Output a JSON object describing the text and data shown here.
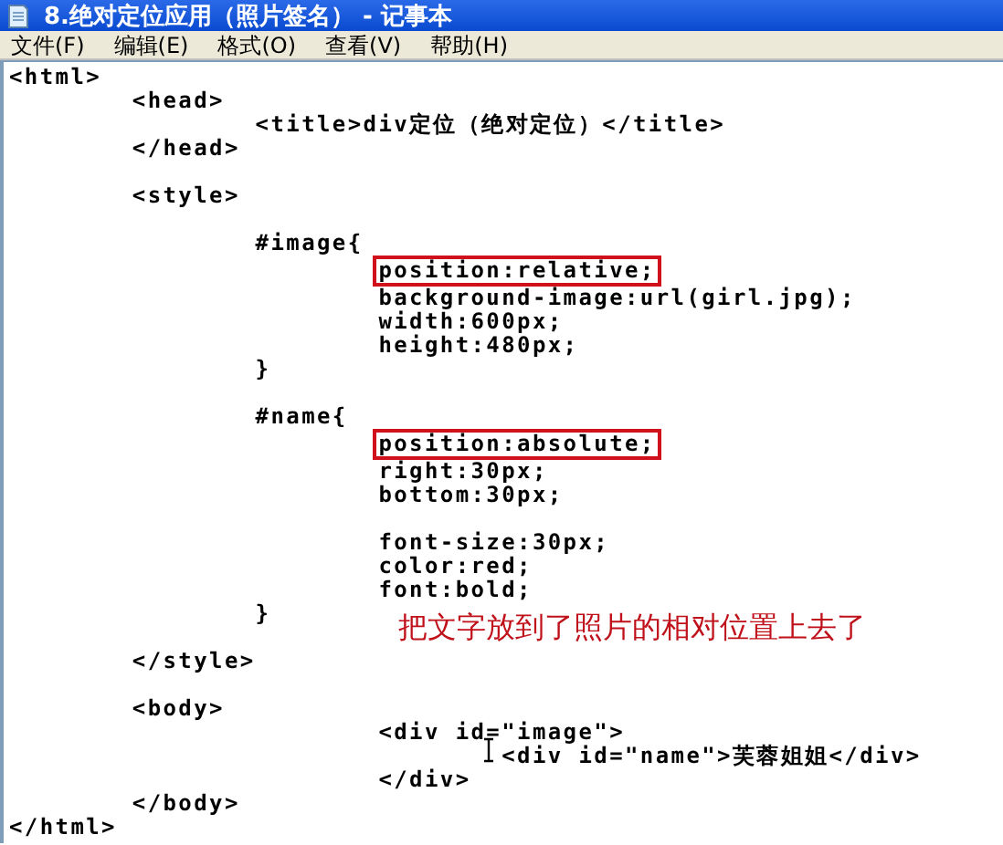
{
  "window": {
    "title": "8.绝对定位应用（照片签名） - 记事本"
  },
  "menu": [
    {
      "label": "文件(F)"
    },
    {
      "label": "编辑(E)"
    },
    {
      "label": "格式(O)"
    },
    {
      "label": "查看(V)"
    },
    {
      "label": "帮助(H)"
    }
  ],
  "lines": [
    {
      "kind": "code",
      "text": "<html>",
      "boxed": false
    },
    {
      "kind": "code",
      "text": "\t<head>",
      "boxed": false
    },
    {
      "kind": "code",
      "text": "\t\t<title>div定位（绝对定位）</title>",
      "boxed": false
    },
    {
      "kind": "code",
      "text": "\t</head>",
      "boxed": false
    },
    {
      "kind": "blank"
    },
    {
      "kind": "code",
      "text": "\t<style>",
      "boxed": false
    },
    {
      "kind": "blank"
    },
    {
      "kind": "code",
      "text": "\t\t#image{",
      "boxed": false
    },
    {
      "kind": "code",
      "text": "\t\t\tposition:relative;",
      "boxed": true
    },
    {
      "kind": "code",
      "text": "\t\t\tbackground-image:url(girl.jpg);",
      "boxed": false
    },
    {
      "kind": "code",
      "text": "\t\t\twidth:600px;",
      "boxed": false
    },
    {
      "kind": "code",
      "text": "\t\t\theight:480px;",
      "boxed": false
    },
    {
      "kind": "code",
      "text": "\t\t}",
      "boxed": false
    },
    {
      "kind": "blank"
    },
    {
      "kind": "code",
      "text": "\t\t#name{",
      "boxed": false
    },
    {
      "kind": "code",
      "text": "\t\t\tposition:absolute;",
      "boxed": true
    },
    {
      "kind": "code",
      "text": "\t\t\tright:30px;",
      "boxed": false
    },
    {
      "kind": "code",
      "text": "\t\t\tbottom:30px;",
      "boxed": false
    },
    {
      "kind": "blank"
    },
    {
      "kind": "code",
      "text": "\t\t\tfont-size:30px;",
      "boxed": false
    },
    {
      "kind": "code",
      "text": "\t\t\tcolor:red;",
      "boxed": false
    },
    {
      "kind": "code",
      "text": "\t\t\tfont:bold;",
      "boxed": false
    },
    {
      "kind": "code",
      "text": "\t\t}",
      "boxed": false
    },
    {
      "kind": "blank"
    },
    {
      "kind": "code",
      "text": "\t</style>",
      "boxed": false
    },
    {
      "kind": "blank"
    },
    {
      "kind": "code",
      "text": "\t<body>",
      "boxed": false
    },
    {
      "kind": "code",
      "text": "\t\t\t<div id=\"image\">",
      "boxed": false
    },
    {
      "kind": "code",
      "text": "\t\t\t\t<div id=\"name\">芙蓉姐姐</div>",
      "boxed": false
    },
    {
      "kind": "code",
      "text": "\t\t\t</div>",
      "boxed": false
    },
    {
      "kind": "code",
      "text": "\t</body>",
      "boxed": false
    },
    {
      "kind": "code",
      "text": "</html>",
      "boxed": false
    }
  ],
  "annotation": {
    "text": "把文字放到了照片的相对位置上去了"
  }
}
